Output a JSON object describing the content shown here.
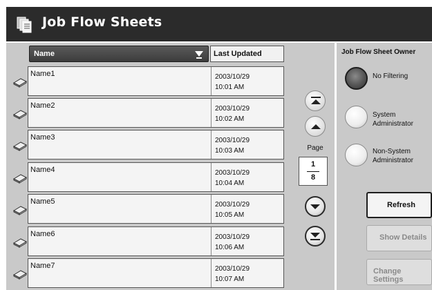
{
  "header": {
    "title": "Job Flow Sheets",
    "icon": "job-flow-sheets-icon"
  },
  "list": {
    "columns": {
      "name": "Name",
      "last_updated": "Last Updated"
    },
    "rows": [
      {
        "name": "Name1",
        "date": "2003/10/29",
        "time": "10:01 AM"
      },
      {
        "name": "Name2",
        "date": "2003/10/29",
        "time": "10:02 AM"
      },
      {
        "name": "Name3",
        "date": "2003/10/29",
        "time": "10:03 AM"
      },
      {
        "name": "Name4",
        "date": "2003/10/29",
        "time": "10:04 AM"
      },
      {
        "name": "Name5",
        "date": "2003/10/29",
        "time": "10:05 AM"
      },
      {
        "name": "Name6",
        "date": "2003/10/29",
        "time": "10:06 AM"
      },
      {
        "name": "Name7",
        "date": "2003/10/29",
        "time": "10:07 AM"
      }
    ]
  },
  "pager": {
    "label": "Page",
    "current": "1",
    "total": "8"
  },
  "owner": {
    "title": "Job Flow Sheet Owner",
    "options": [
      {
        "label": "No Filtering",
        "selected": true
      },
      {
        "label": "System Administrator",
        "selected": false
      },
      {
        "label": "Non-System Administrator",
        "selected": false
      }
    ]
  },
  "actions": {
    "refresh": "Refresh",
    "show_details": "Show Details",
    "change_settings": "Change Settings"
  },
  "colors": {
    "titlebar": "#2b2b2b",
    "panel": "#c9c9c9",
    "header_selected": "#4a4a4a"
  }
}
